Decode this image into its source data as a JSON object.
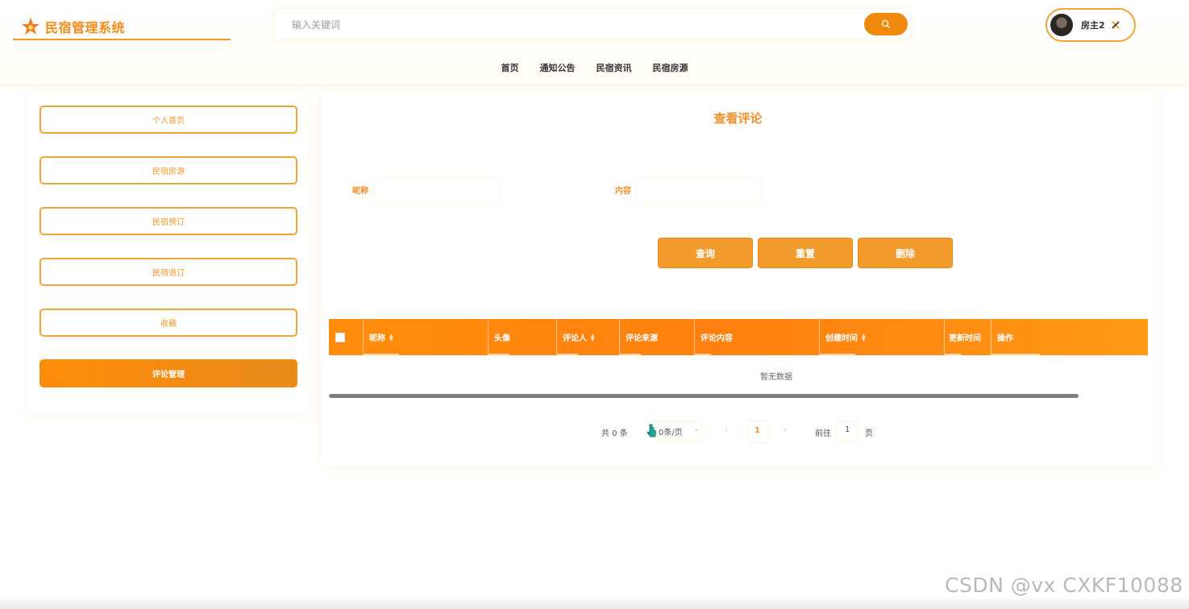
{
  "header": {
    "app_title": "民宿管理系统",
    "search_placeholder": "输入关键词",
    "user_name": "房主2"
  },
  "nav": {
    "items": [
      "首页",
      "通知公告",
      "民宿资讯",
      "民宿房源"
    ]
  },
  "sidebar": {
    "items": [
      {
        "label": "个人首页",
        "active": false
      },
      {
        "label": "民宿房源",
        "active": false
      },
      {
        "label": "民宿预订",
        "active": false
      },
      {
        "label": "民宿退订",
        "active": false
      },
      {
        "label": "收藏",
        "active": false
      },
      {
        "label": "评论管理",
        "active": true
      }
    ]
  },
  "main": {
    "title": "查看评论",
    "filters": {
      "nickname_label": "昵称",
      "content_label": "内容"
    },
    "actions": {
      "query": "查询",
      "reset": "重置",
      "delete": "删除"
    },
    "table": {
      "columns": [
        "昵称",
        "头像",
        "评论人",
        "评论来源",
        "评论内容",
        "创建时间",
        "更新时间",
        "操作"
      ],
      "empty_text": "暂无数据"
    },
    "pager": {
      "total": "共 0 条",
      "page_size": "0条/页",
      "current_page": "1",
      "goto_label": "前往",
      "goto_value": "1",
      "page_suffix": "页"
    }
  },
  "watermark": "CSDN @vx  CXKF10088",
  "colors": {
    "accent": "#f08a0e",
    "accent_light": "#f39a2c",
    "border": "#f0a53a"
  },
  "icons": [
    "star-logo-icon",
    "search-icon",
    "avatar",
    "close-icon",
    "chevron-left-icon",
    "chevron-right-icon",
    "chevron-down-icon",
    "sort-icon",
    "cursor-icon"
  ]
}
